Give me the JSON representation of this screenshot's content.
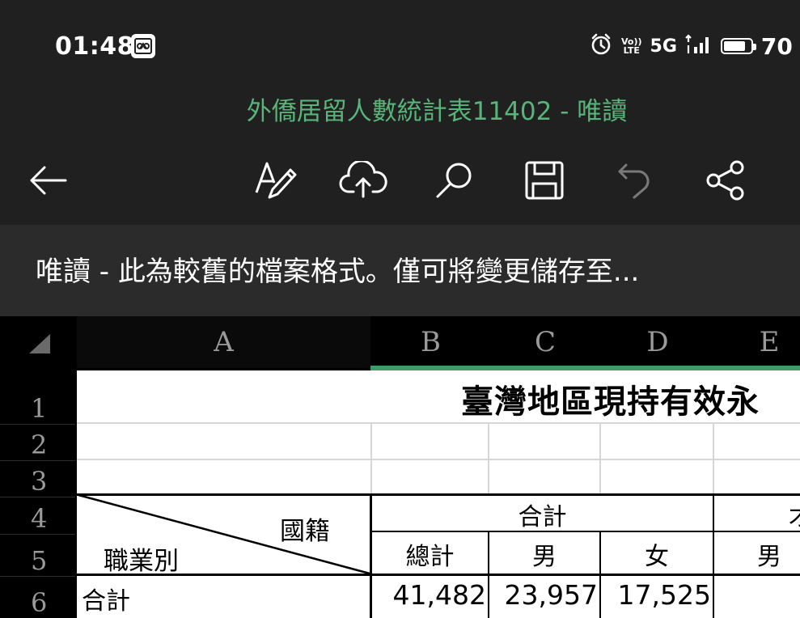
{
  "status_bar": {
    "time": "01:48",
    "left_icon": "gallery-app-icon",
    "right_icons": [
      "alarm-icon",
      "volte-icon",
      "5g-indicator",
      "signal-icon",
      "battery-icon"
    ],
    "volte_top": "Vo))",
    "volte_bottom": "LTE",
    "network": "5G",
    "battery": "70"
  },
  "document": {
    "title": "外僑居留人數統計表11402 - 唯讀"
  },
  "toolbar": {
    "icons": [
      "back-arrow-icon",
      "font-format-icon",
      "cloud-upload-icon",
      "search-icon",
      "save-icon",
      "undo-icon",
      "share-icon"
    ]
  },
  "banner": {
    "text": "唯讀 - 此為較舊的檔案格式。僅可將變更儲存至..."
  },
  "spreadsheet": {
    "columns": [
      "A",
      "B",
      "C",
      "D",
      "E"
    ],
    "rows": [
      "1",
      "2",
      "3",
      "4",
      "5",
      "6"
    ],
    "title": "臺灣地區現持有效永",
    "header_group": "合計",
    "header_partial": "才",
    "diag_top": "國籍",
    "diag_bottom": "職業別",
    "col_labels": [
      "總計",
      "男",
      "女",
      "男"
    ],
    "row6_label": "合計",
    "row6_values": [
      "41,482",
      "23,957",
      "17,525"
    ],
    "colors": {
      "accent": "#3f9a67",
      "title_green": "#58b478"
    }
  }
}
